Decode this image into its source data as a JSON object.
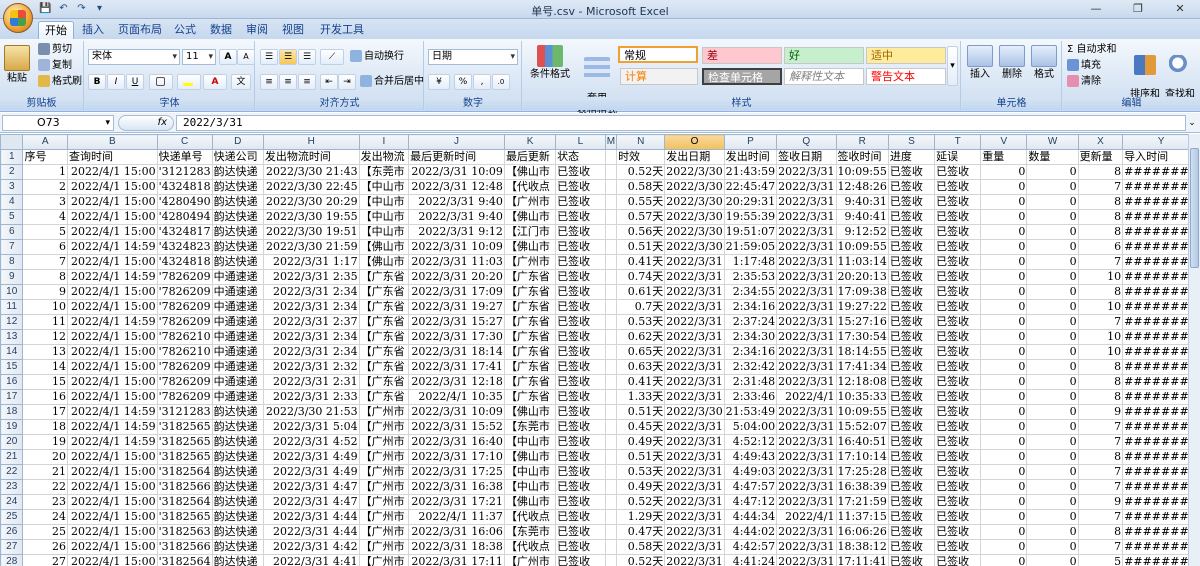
{
  "window": {
    "title": "单号.csv - Microsoft Excel",
    "controls": [
      "—",
      "❐",
      "✕"
    ]
  },
  "qat": [
    "💾",
    "↶",
    "↷",
    "▾"
  ],
  "tabs": [
    "开始",
    "插入",
    "页面布局",
    "公式",
    "数据",
    "审阅",
    "视图",
    "开发工具"
  ],
  "ribbon": {
    "clipboard": {
      "label": "剪贴板",
      "paste": "粘贴",
      "cut": "剪切",
      "copy": "复制",
      "painter": "格式刷"
    },
    "font": {
      "label": "字体",
      "name": "宋体",
      "size": "11",
      "bold": "B",
      "italic": "I",
      "underline": "U",
      "grow": "A",
      "shrink": "A"
    },
    "align": {
      "label": "对齐方式",
      "wrap": "自动换行",
      "merge": "合并后居中"
    },
    "number": {
      "label": "数字",
      "format": "日期",
      "percent": "%",
      "comma": ","
    },
    "styles": {
      "label": "样式",
      "cond": "条件格式",
      "table": "套用\n表格格式",
      "cells": [
        {
          "text": "常规",
          "bg": "#ffffff",
          "fg": "#000000"
        },
        {
          "text": "差",
          "bg": "#ffc7ce",
          "fg": "#9c0006"
        },
        {
          "text": "好",
          "bg": "#c6efce",
          "fg": "#006100"
        },
        {
          "text": "适中",
          "bg": "#ffeb9c",
          "fg": "#9c6500"
        },
        {
          "text": "计算",
          "bg": "#f2f2f2",
          "fg": "#fa7d00"
        },
        {
          "text": "检查单元格",
          "bg": "#a5a5a5",
          "fg": "#ffffff"
        },
        {
          "text": "解释性文本",
          "bg": "#ffffff",
          "fg": "#7f7f7f"
        },
        {
          "text": "警告文本",
          "bg": "#ffffff",
          "fg": "#ff0000"
        }
      ]
    },
    "cells": {
      "label": "单元格",
      "insert": "插入",
      "delete": "删除",
      "format": "格式"
    },
    "editing": {
      "label": "编辑",
      "autosum": "自动求和",
      "fill": "填充",
      "clear": "清除",
      "sort": "排序和\n筛选",
      "find": "查找和\n选择"
    }
  },
  "formula_bar": {
    "name_box": "O73",
    "fx": "fx",
    "value": "2022/3/31"
  },
  "columns": [
    "A",
    "B",
    "C",
    "D",
    "H",
    "I",
    "J",
    "K",
    "L",
    "M",
    "N",
    "O",
    "P",
    "Q",
    "R",
    "S",
    "T",
    "V",
    "W",
    "X",
    "Y"
  ],
  "header_row": [
    "序号",
    "查询时间",
    "快递单号",
    "快递公司",
    "发出物流时间",
    "发出物流",
    "最后更新时间",
    "最后更新",
    "状态",
    "",
    "时效",
    "发出日期",
    "发出时间",
    "签收日期",
    "签收时间",
    "进度",
    "延误",
    "重量",
    "数量",
    "更新量",
    "导入时间"
  ],
  "rows": [
    [
      "1",
      "2022/4/1 15:00",
      "'3121283",
      "韵达快递",
      "2022/3/30 21:43",
      "【东莞市",
      "2022/3/31 10:09",
      "【佛山市",
      "已签收",
      "",
      "0.52天",
      "2022/3/30",
      "21:43:59",
      "2022/3/31",
      "10:09:55",
      "已签收",
      "已签收",
      "0",
      "0",
      "8",
      "########"
    ],
    [
      "2",
      "2022/4/1 15:00",
      "'4324818",
      "韵达快递",
      "2022/3/30 22:45",
      "【中山市",
      "2022/3/31 12:48",
      "【代收点",
      "已签收",
      "",
      "0.58天",
      "2022/3/30",
      "22:45:47",
      "2022/3/31",
      "12:48:26",
      "已签收",
      "已签收",
      "0",
      "0",
      "7",
      "########"
    ],
    [
      "3",
      "2022/4/1 15:00",
      "'4280490",
      "韵达快递",
      "2022/3/30 20:29",
      "【中山市",
      "2022/3/31 9:40",
      "【广州市",
      "已签收",
      "",
      "0.55天",
      "2022/3/30",
      "20:29:31",
      "2022/3/31",
      "9:40:31",
      "已签收",
      "已签收",
      "0",
      "0",
      "8",
      "########"
    ],
    [
      "4",
      "2022/4/1 15:00",
      "'4280494",
      "韵达快递",
      "2022/3/30 19:55",
      "【中山市",
      "2022/3/31 9:40",
      "【佛山市",
      "已签收",
      "",
      "0.57天",
      "2022/3/30",
      "19:55:39",
      "2022/3/31",
      "9:40:41",
      "已签收",
      "已签收",
      "0",
      "0",
      "8",
      "########"
    ],
    [
      "5",
      "2022/4/1 15:00",
      "'4324817",
      "韵达快递",
      "2022/3/30 19:51",
      "【中山市",
      "2022/3/31 9:12",
      "【江门市",
      "已签收",
      "",
      "0.56天",
      "2022/3/30",
      "19:51:07",
      "2022/3/31",
      "9:12:52",
      "已签收",
      "已签收",
      "0",
      "0",
      "8",
      "########"
    ],
    [
      "6",
      "2022/4/1 14:59",
      "'4324823",
      "韵达快递",
      "2022/3/30 21:59",
      "【佛山市",
      "2022/3/31 10:09",
      "【佛山市",
      "已签收",
      "",
      "0.51天",
      "2022/3/30",
      "21:59:05",
      "2022/3/31",
      "10:09:55",
      "已签收",
      "已签收",
      "0",
      "0",
      "6",
      "########"
    ],
    [
      "7",
      "2022/4/1 15:00",
      "'4324818",
      "韵达快递",
      "2022/3/31 1:17",
      "【佛山市",
      "2022/3/31 11:03",
      "【广州市",
      "已签收",
      "",
      "0.41天",
      "2022/3/31",
      "1:17:48",
      "2022/3/31",
      "11:03:14",
      "已签收",
      "已签收",
      "0",
      "0",
      "7",
      "########"
    ],
    [
      "8",
      "2022/4/1 14:59",
      "'7826209",
      "中通速递",
      "2022/3/31 2:35",
      "【广东省",
      "2022/3/31 20:20",
      "【广东省",
      "已签收",
      "",
      "0.74天",
      "2022/3/31",
      "2:35:53",
      "2022/3/31",
      "20:20:13",
      "已签收",
      "已签收",
      "0",
      "0",
      "10",
      "########"
    ],
    [
      "9",
      "2022/4/1 15:00",
      "'7826209",
      "中通速递",
      "2022/3/31 2:34",
      "【广东省",
      "2022/3/31 17:09",
      "【广东省",
      "已签收",
      "",
      "0.61天",
      "2022/3/31",
      "2:34:55",
      "2022/3/31",
      "17:09:38",
      "已签收",
      "已签收",
      "0",
      "0",
      "8",
      "########"
    ],
    [
      "10",
      "2022/4/1 15:00",
      "'7826209",
      "中通速递",
      "2022/3/31 2:34",
      "【广东省",
      "2022/3/31 19:27",
      "【广东省",
      "已签收",
      "",
      "0.7天",
      "2022/3/31",
      "2:34:16",
      "2022/3/31",
      "19:27:22",
      "已签收",
      "已签收",
      "0",
      "0",
      "10",
      "########"
    ],
    [
      "11",
      "2022/4/1 14:59",
      "'7826209",
      "中通速递",
      "2022/3/31 2:37",
      "【广东省",
      "2022/3/31 15:27",
      "【广东省",
      "已签收",
      "",
      "0.53天",
      "2022/3/31",
      "2:37:24",
      "2022/3/31",
      "15:27:16",
      "已签收",
      "已签收",
      "0",
      "0",
      "7",
      "########"
    ],
    [
      "12",
      "2022/4/1 15:00",
      "'7826210",
      "中通速递",
      "2022/3/31 2:34",
      "【广东省",
      "2022/3/31 17:30",
      "【广东省",
      "已签收",
      "",
      "0.62天",
      "2022/3/31",
      "2:34:30",
      "2022/3/31",
      "17:30:54",
      "已签收",
      "已签收",
      "0",
      "0",
      "10",
      "########"
    ],
    [
      "13",
      "2022/4/1 15:00",
      "'7826210",
      "中通速递",
      "2022/3/31 2:34",
      "【广东省",
      "2022/3/31 18:14",
      "【广东省",
      "已签收",
      "",
      "0.65天",
      "2022/3/31",
      "2:34:16",
      "2022/3/31",
      "18:14:55",
      "已签收",
      "已签收",
      "0",
      "0",
      "10",
      "########"
    ],
    [
      "14",
      "2022/4/1 15:00",
      "'7826209",
      "中通速递",
      "2022/3/31 2:32",
      "【广东省",
      "2022/3/31 17:41",
      "【广东省",
      "已签收",
      "",
      "0.63天",
      "2022/3/31",
      "2:32:42",
      "2022/3/31",
      "17:41:34",
      "已签收",
      "已签收",
      "0",
      "0",
      "8",
      "########"
    ],
    [
      "15",
      "2022/4/1 15:00",
      "'7826209",
      "中通速递",
      "2022/3/31 2:31",
      "【广东省",
      "2022/3/31 12:18",
      "【广东省",
      "已签收",
      "",
      "0.41天",
      "2022/3/31",
      "2:31:48",
      "2022/3/31",
      "12:18:08",
      "已签收",
      "已签收",
      "0",
      "0",
      "8",
      "########"
    ],
    [
      "16",
      "2022/4/1 15:00",
      "'7826209",
      "中通速递",
      "2022/3/31 2:33",
      "【广东省",
      "2022/4/1 10:35",
      "【广东省",
      "已签收",
      "",
      "1.33天",
      "2022/3/31",
      "2:33:46",
      "2022/4/1",
      "10:35:33",
      "已签收",
      "已签收",
      "0",
      "0",
      "8",
      "########"
    ],
    [
      "17",
      "2022/4/1 14:59",
      "'3121283",
      "韵达快递",
      "2022/3/30 21:53",
      "【广州市",
      "2022/3/31 10:09",
      "【佛山市",
      "已签收",
      "",
      "0.51天",
      "2022/3/30",
      "21:53:49",
      "2022/3/31",
      "10:09:55",
      "已签收",
      "已签收",
      "0",
      "0",
      "9",
      "########"
    ],
    [
      "18",
      "2022/4/1 14:59",
      "'3182565",
      "韵达快递",
      "2022/3/31 5:04",
      "【广州市",
      "2022/3/31 15:52",
      "【东莞市",
      "已签收",
      "",
      "0.45天",
      "2022/3/31",
      "5:04:00",
      "2022/3/31",
      "15:52:07",
      "已签收",
      "已签收",
      "0",
      "0",
      "7",
      "########"
    ],
    [
      "19",
      "2022/4/1 14:59",
      "'3182565",
      "韵达快递",
      "2022/3/31 4:52",
      "【广州市",
      "2022/3/31 16:40",
      "【中山市",
      "已签收",
      "",
      "0.49天",
      "2022/3/31",
      "4:52:12",
      "2022/3/31",
      "16:40:51",
      "已签收",
      "已签收",
      "0",
      "0",
      "7",
      "########"
    ],
    [
      "20",
      "2022/4/1 15:00",
      "'3182565",
      "韵达快递",
      "2022/3/31 4:49",
      "【广州市",
      "2022/3/31 17:10",
      "【佛山市",
      "已签收",
      "",
      "0.51天",
      "2022/3/31",
      "4:49:43",
      "2022/3/31",
      "17:10:14",
      "已签收",
      "已签收",
      "0",
      "0",
      "8",
      "########"
    ],
    [
      "21",
      "2022/4/1 15:00",
      "'3182564",
      "韵达快递",
      "2022/3/31 4:49",
      "【广州市",
      "2022/3/31 17:25",
      "【中山市",
      "已签收",
      "",
      "0.53天",
      "2022/3/31",
      "4:49:03",
      "2022/3/31",
      "17:25:28",
      "已签收",
      "已签收",
      "0",
      "0",
      "7",
      "########"
    ],
    [
      "22",
      "2022/4/1 15:00",
      "'3182566",
      "韵达快递",
      "2022/3/31 4:47",
      "【广州市",
      "2022/3/31 16:38",
      "【中山市",
      "已签收",
      "",
      "0.49天",
      "2022/3/31",
      "4:47:57",
      "2022/3/31",
      "16:38:39",
      "已签收",
      "已签收",
      "0",
      "0",
      "7",
      "########"
    ],
    [
      "23",
      "2022/4/1 15:00",
      "'3182564",
      "韵达快递",
      "2022/3/31 4:47",
      "【广州市",
      "2022/3/31 17:21",
      "【佛山市",
      "已签收",
      "",
      "0.52天",
      "2022/3/31",
      "4:47:12",
      "2022/3/31",
      "17:21:59",
      "已签收",
      "已签收",
      "0",
      "0",
      "9",
      "########"
    ],
    [
      "24",
      "2022/4/1 15:00",
      "'3182565",
      "韵达快递",
      "2022/3/31 4:44",
      "【广州市",
      "2022/4/1 11:37",
      "【代收点",
      "已签收",
      "",
      "1.29天",
      "2022/3/31",
      "4:44:34",
      "2022/4/1",
      "11:37:15",
      "已签收",
      "已签收",
      "0",
      "0",
      "7",
      "########"
    ],
    [
      "25",
      "2022/4/1 15:00",
      "'3182563",
      "韵达快递",
      "2022/3/31 4:44",
      "【广州市",
      "2022/3/31 16:06",
      "【东莞市",
      "已签收",
      "",
      "0.47天",
      "2022/3/31",
      "4:44:02",
      "2022/3/31",
      "16:06:26",
      "已签收",
      "已签收",
      "0",
      "0",
      "8",
      "########"
    ],
    [
      "26",
      "2022/4/1 15:00",
      "'3182566",
      "韵达快递",
      "2022/3/31 4:42",
      "【广州市",
      "2022/3/31 18:38",
      "【代收点",
      "已签收",
      "",
      "0.58天",
      "2022/3/31",
      "4:42:57",
      "2022/3/31",
      "18:38:12",
      "已签收",
      "已签收",
      "0",
      "0",
      "7",
      "########"
    ],
    [
      "27",
      "2022/4/1 15:00",
      "'3182564",
      "韵达快递",
      "2022/3/31 4:41",
      "【广州市",
      "2022/3/31 17:11",
      "【广州市",
      "已签收",
      "",
      "0.52天",
      "2022/3/31",
      "4:41:24",
      "2022/3/31",
      "17:11:41",
      "已签收",
      "已签收",
      "0",
      "0",
      "5",
      "########"
    ]
  ]
}
